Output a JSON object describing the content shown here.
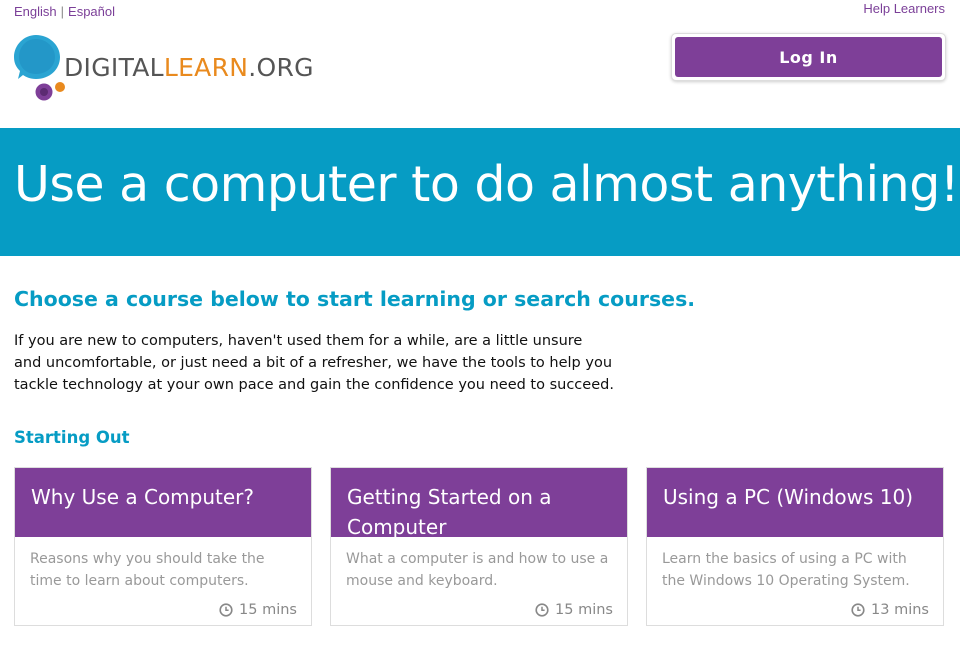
{
  "languages": {
    "english": "English",
    "separator": "|",
    "spanish": "Español"
  },
  "help_link": "Help Learners",
  "logo": {
    "digital": "DIGITAL",
    "learn": "LEARN",
    "org": ".ORG"
  },
  "login_label": "Log In",
  "hero_title": "Use a computer to do almost anything!",
  "choose_heading": "Choose a course below to start learning or search courses.",
  "intro_text": "If you are new to computers, haven't used them for a while, are a little unsure and uncomfortable, or just need a bit of a refresher, we have the tools to help you tackle technology at your own pace and gain the confidence you need to succeed.",
  "section_title": "Starting Out",
  "courses": [
    {
      "title": "Why Use a Computer?",
      "description": "Reasons why you should take the time to learn about computers.",
      "duration": "15 mins"
    },
    {
      "title": "Getting Started on a Computer",
      "description": "What a computer is and how to use a mouse and keyboard.",
      "duration": "15 mins"
    },
    {
      "title": "Using a PC (Windows 10)",
      "description": "Learn the basics of using a PC with the Windows 10 Operating System.",
      "duration": "13 mins"
    }
  ],
  "colors": {
    "purple": "#7e3f98",
    "teal": "#069cc4",
    "orange": "#e98a1e"
  },
  "icons": {
    "clock": "clock-icon"
  }
}
